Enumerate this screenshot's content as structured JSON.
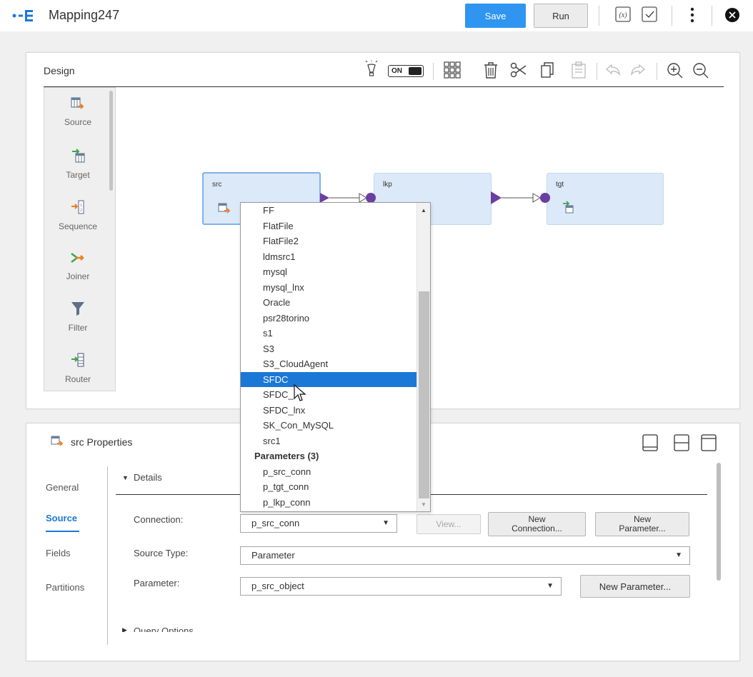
{
  "app": {
    "title": "Mapping247"
  },
  "toolbar": {
    "save_label": "Save",
    "run_label": "Run"
  },
  "design": {
    "title": "Design",
    "toggle_label": "ON",
    "palette": [
      {
        "label": "Source",
        "icon": "source-icon"
      },
      {
        "label": "Target",
        "icon": "target-icon"
      },
      {
        "label": "Sequence",
        "icon": "sequence-icon"
      },
      {
        "label": "Joiner",
        "icon": "joiner-icon"
      },
      {
        "label": "Filter",
        "icon": "filter-icon"
      },
      {
        "label": "Router",
        "icon": "router-icon"
      }
    ],
    "nodes": [
      {
        "name": "src"
      },
      {
        "name": "lkp"
      },
      {
        "name": "tgt"
      }
    ]
  },
  "dropdown": {
    "items": [
      "FF",
      "FlatFile",
      "FlatFile2",
      "ldmsrc1",
      "mysql",
      "mysql_lnx",
      "Oracle",
      "psr28torino",
      "s1",
      "S3",
      "S3_CloudAgent",
      "SFDC",
      "SFDC_",
      "SFDC_lnx",
      "SK_Con_MySQL",
      "src1"
    ],
    "highlighted": "SFDC",
    "group_label": "Parameters (3)",
    "params": [
      "p_src_conn",
      "p_tgt_conn",
      "p_lkp_conn"
    ]
  },
  "properties": {
    "title": "src Properties",
    "tabs": [
      "General",
      "Source",
      "Fields",
      "Partitions"
    ],
    "active_tab": "Source",
    "section_details": "Details",
    "section_query": "Query Options",
    "connection_label": "Connection:",
    "connection_value": "p_src_conn",
    "view_label": "View...",
    "new_connection_label": [
      "New",
      "Connection..."
    ],
    "new_parameter_label": [
      "New",
      "Parameter..."
    ],
    "source_type_label": "Source Type:",
    "source_type_value": "Parameter",
    "parameter_label": "Parameter:",
    "parameter_value": "p_src_object",
    "new_parameter_btn": "New Parameter..."
  },
  "colors": {
    "accent": "#2f95f0",
    "highlight": "#1c78d6",
    "node_fill": "#dbe9f8",
    "link_purple": "#6a3fa0"
  }
}
